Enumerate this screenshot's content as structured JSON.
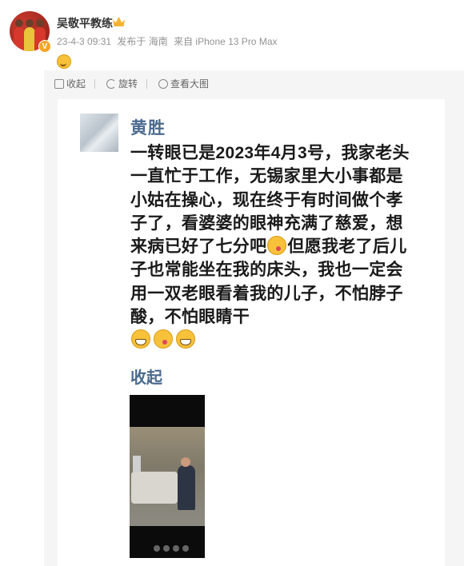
{
  "header": {
    "username": "吴敬平教练",
    "verified_badge": "V",
    "crown_icon": "crown-icon",
    "date": "23-4-3 09:31",
    "location": "发布于 海南",
    "device": "来自 iPhone 13 Pro Max",
    "emoji_icon": "smile-icon"
  },
  "toolbar": {
    "collect_label": "收起",
    "rotate_label": "旋转",
    "view_large_label": "查看大图"
  },
  "post": {
    "author": "黄胜",
    "text": "一转眼已是2023年4月3号，我家老头一直忙于工作，无锡家里大小事都是小姑在操心，现在终于有时间做个孝子了，看婆婆的眼神充满了慈爱，想来病已好了七分吧",
    "text_cont": "但愿我老了后儿子也常能坐在我的床头，我也一定会用一双老眼看着我的儿子，不怕脖子酸，不怕眼睛干",
    "collapse_label": "收起",
    "emojis": [
      "wink-emoji",
      "grin-emoji",
      "wink-emoji",
      "grin-emoji"
    ]
  },
  "colors": {
    "link": "#4b6a8e",
    "feed_bg": "#f5f5f5",
    "meta_text": "#939393"
  }
}
